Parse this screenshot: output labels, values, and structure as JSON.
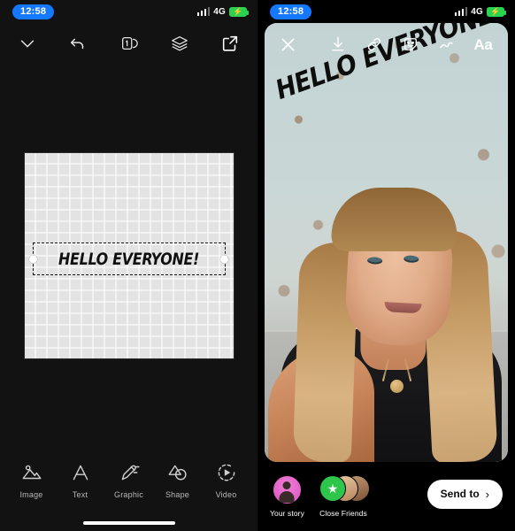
{
  "status_bar": {
    "time": "12:58",
    "network": "4G",
    "battery_icon": "battery-charging-icon",
    "signal_icon": "signal-bars-icon"
  },
  "editor": {
    "toolbar": [
      {
        "name": "collapse-button",
        "icon": "chevron-down-icon"
      },
      {
        "name": "undo-button",
        "icon": "undo-arrow-icon"
      },
      {
        "name": "pages-button",
        "icon": "pages-icon",
        "badge": "1"
      },
      {
        "name": "layers-button",
        "icon": "layers-icon"
      },
      {
        "name": "export-button",
        "icon": "export-icon"
      }
    ],
    "canvas": {
      "selected_text": "HELLO EVERYONE!",
      "handle_left": "resize-handle-left",
      "handle_right": "resize-handle-right"
    },
    "tools": [
      {
        "label": "Image",
        "icon": "image-icon"
      },
      {
        "label": "Text",
        "icon": "text-icon"
      },
      {
        "label": "Graphic",
        "icon": "graphic-icon"
      },
      {
        "label": "Shape",
        "icon": "shape-icon"
      },
      {
        "label": "Video",
        "icon": "video-icon"
      }
    ]
  },
  "story": {
    "close_label": "close-icon",
    "actions": [
      {
        "name": "save-button",
        "icon": "download-icon"
      },
      {
        "name": "link-button",
        "icon": "link-icon"
      },
      {
        "name": "sticker-button",
        "icon": "sticker-icon"
      },
      {
        "name": "draw-button",
        "icon": "draw-icon"
      },
      {
        "name": "text-button",
        "icon": "text-aa-icon",
        "label": "Aa"
      }
    ],
    "overlay_text": "HELLO EVERYONE!",
    "share": {
      "your_story_label": "Your story",
      "close_friends_label": "Close Friends",
      "send_to_label": "Send to",
      "send_to_chevron": "›"
    }
  },
  "colors": {
    "accent_blue": "#1479ff",
    "battery_green": "#2bd450",
    "close_friends_green": "#2ec64a",
    "story_avatar_pink": "#e05fc9",
    "panel_dark": "#121212"
  }
}
